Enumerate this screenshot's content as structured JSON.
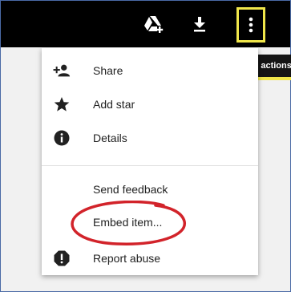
{
  "colors": {
    "topbar": "#000000",
    "highlight": "#f0e64a",
    "annotation": "#d2232a",
    "menu_bg": "#ffffff",
    "icon": "#212121"
  },
  "toolbar": {
    "icons": [
      "add-to-drive-icon",
      "download-icon",
      "more-vert-icon"
    ],
    "tooltip": "More actions"
  },
  "menu": {
    "share": {
      "label": "Share",
      "icon": "person-add-icon"
    },
    "add_star": {
      "label": "Add star",
      "icon": "star-icon"
    },
    "details": {
      "label": "Details",
      "icon": "info-icon"
    },
    "send_feedback": {
      "label": "Send feedback"
    },
    "embed_item": {
      "label": "Embed item..."
    },
    "report_abuse": {
      "label": "Report abuse",
      "icon": "report-icon"
    }
  }
}
